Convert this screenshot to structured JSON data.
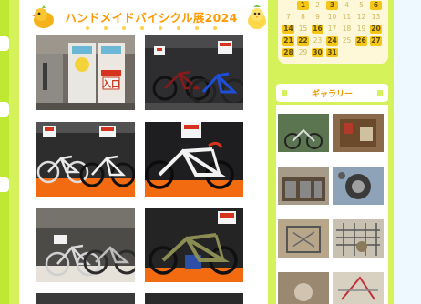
{
  "article": {
    "title": "ハンドメイドバイシクル展2024"
  },
  "entrance_sign": {
    "label": "入口"
  },
  "calendar": {
    "rows": [
      [
        "",
        "1",
        "2",
        "3",
        "4",
        "5",
        "6"
      ],
      [
        "7",
        "8",
        "9",
        "10",
        "11",
        "12",
        "13"
      ],
      [
        "14",
        "15",
        "16",
        "17",
        "18",
        "19",
        "20"
      ],
      [
        "21",
        "22",
        "23",
        "24",
        "25",
        "26",
        "27"
      ],
      [
        "28",
        "29",
        "30",
        "31",
        "",
        "",
        ""
      ]
    ]
  },
  "sidebar": {
    "gallery_title": "ギャラリー"
  },
  "colors": {
    "page_bg": "#d6f25a",
    "accent_orange": "#ff9900",
    "calendar_highlight": "#f5c518"
  }
}
